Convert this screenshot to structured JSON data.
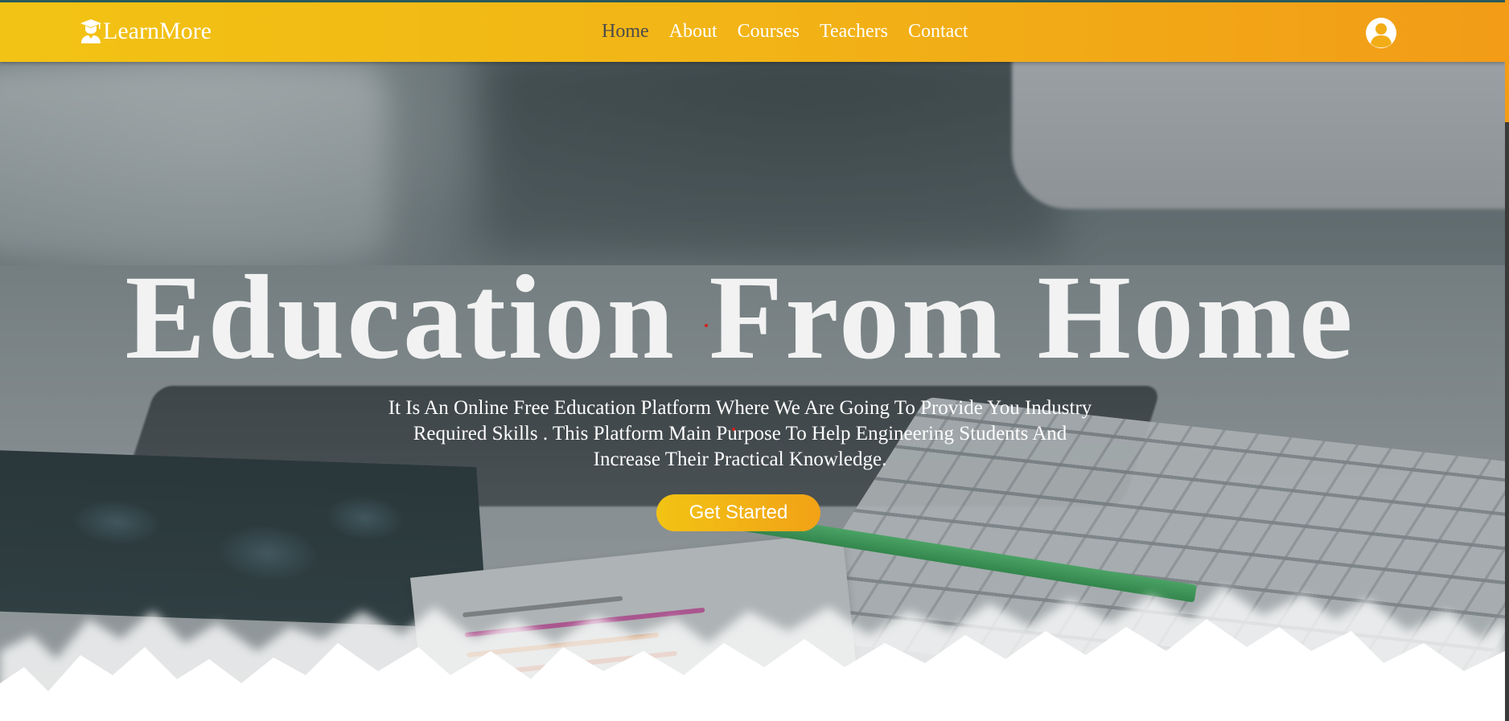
{
  "brand": {
    "name": "LearnMore",
    "icon": "graduate-icon"
  },
  "nav": {
    "items": [
      {
        "label": "Home",
        "active": true
      },
      {
        "label": "About",
        "active": false
      },
      {
        "label": "Courses",
        "active": false
      },
      {
        "label": "Teachers",
        "active": false
      },
      {
        "label": "Contact",
        "active": false
      }
    ],
    "account_icon": "user-circle-icon"
  },
  "hero": {
    "title": "Education From Home",
    "subtitle": "It Is An Online Free Education Platform Where We Are Going To Provide You Industry Required Skills . This Platform Main Purpose To Help Engineering Students And Increase Their Practical Knowledge.",
    "cta_label": "Get Started"
  },
  "colors": {
    "nav_gradient_start": "#f2c314",
    "nav_gradient_end": "#f29c17",
    "active_link": "#4b4b4b",
    "text_light": "#ffffff",
    "top_border": "#2a5a5c"
  }
}
